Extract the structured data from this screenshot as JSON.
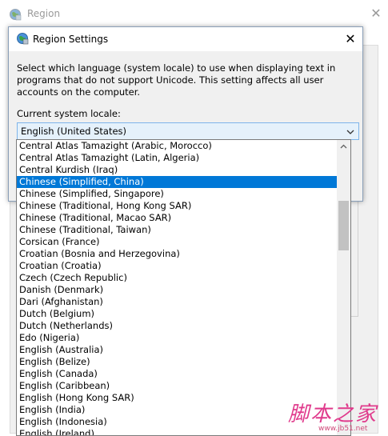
{
  "background_window": {
    "title": "Region",
    "close_glyph": "✕"
  },
  "dialog": {
    "title": "Region Settings",
    "close_glyph": "✕",
    "description": "Select which language (system locale) to use when displaying text in programs that do not support Unicode. This setting affects all user accounts on the computer.",
    "locale_label": "Current system locale:",
    "locale_value": "English (United States)"
  },
  "dropdown": {
    "selected_index": 3,
    "items": [
      "Central Atlas Tamazight (Arabic, Morocco)",
      "Central Atlas Tamazight (Latin, Algeria)",
      "Central Kurdish (Iraq)",
      "Chinese (Simplified, China)",
      "Chinese (Simplified, Singapore)",
      "Chinese (Traditional, Hong Kong SAR)",
      "Chinese (Traditional, Macao SAR)",
      "Chinese (Traditional, Taiwan)",
      "Corsican (France)",
      "Croatian (Bosnia and Herzegovina)",
      "Croatian (Croatia)",
      "Czech (Czech Republic)",
      "Danish (Denmark)",
      "Dari (Afghanistan)",
      "Dutch (Belgium)",
      "Dutch (Netherlands)",
      "Edo (Nigeria)",
      "English (Australia)",
      "English (Belize)",
      "English (Canada)",
      "English (Caribbean)",
      "English (Hong Kong SAR)",
      "English (India)",
      "English (Indonesia)",
      "English (Ireland)"
    ]
  },
  "watermark": {
    "main": "脚本之家",
    "url": "www.jb51.net"
  },
  "colors": {
    "selection": "#0078d7",
    "select_bg": "#e5f1fb",
    "select_border": "#7eb4ea",
    "watermark": "#e03a8c"
  }
}
